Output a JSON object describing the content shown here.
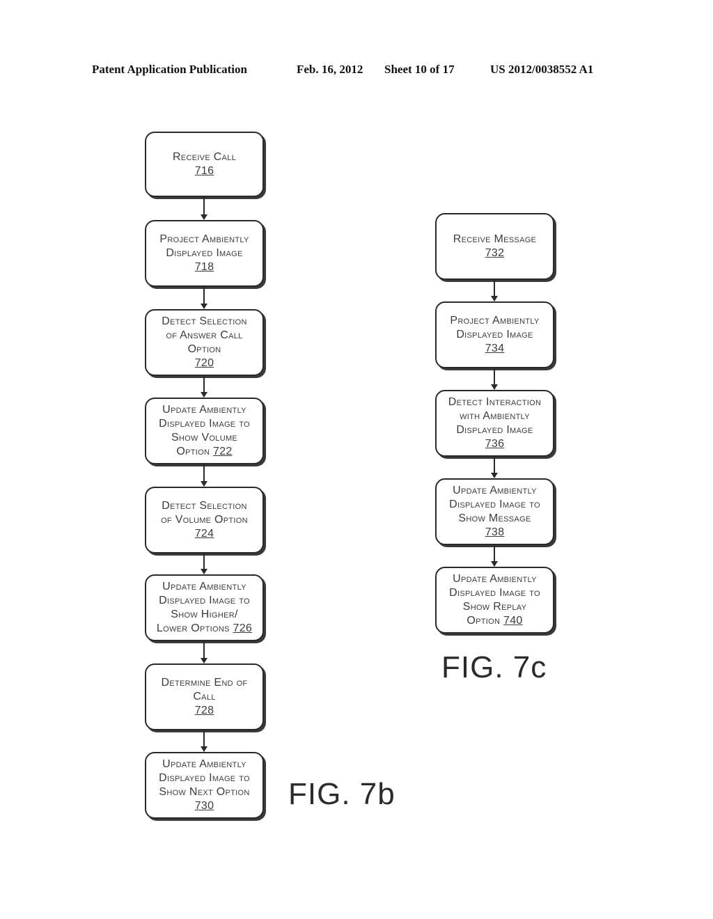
{
  "header": {
    "publication": "Patent Application Publication",
    "date": "Feb. 16, 2012",
    "sheet": "Sheet 10 of 17",
    "patent_number": "US 2012/0038552 A1"
  },
  "fig7b": {
    "label": "FIG. 7b",
    "steps": [
      {
        "lines": [
          "Receive Call"
        ],
        "ref": "716"
      },
      {
        "lines": [
          "Project Ambiently",
          "Displayed Image"
        ],
        "ref": "718"
      },
      {
        "lines": [
          "Detect Selection",
          "of Answer Call",
          "Option"
        ],
        "ref": "720"
      },
      {
        "lines": [
          "Update Ambiently",
          "Displayed Image to",
          "Show Volume"
        ],
        "last_line_prefix": "Option",
        "ref": "722"
      },
      {
        "lines": [
          "Detect Selection",
          "of Volume Option"
        ],
        "ref": "724"
      },
      {
        "lines": [
          "Update Ambiently",
          "Displayed Image to",
          "Show Higher/"
        ],
        "last_line_prefix": "Lower Options",
        "ref": "726"
      },
      {
        "lines": [
          "Determine End of",
          "Call"
        ],
        "ref": "728"
      },
      {
        "lines": [
          "Update Ambiently",
          "Displayed Image to",
          "Show Next Option"
        ],
        "ref": "730"
      }
    ]
  },
  "fig7c": {
    "label": "FIG. 7c",
    "steps": [
      {
        "lines": [
          "Receive Message"
        ],
        "ref": "732"
      },
      {
        "lines": [
          "Project Ambiently",
          "Displayed Image"
        ],
        "ref": "734"
      },
      {
        "lines": [
          "Detect Interaction",
          "with Ambiently",
          "Displayed Image"
        ],
        "ref": "736"
      },
      {
        "lines": [
          "Update Ambiently",
          "Displayed Image to",
          "Show Message"
        ],
        "ref": "738"
      },
      {
        "lines": [
          "Update Ambiently",
          "Displayed Image to",
          "Show Replay"
        ],
        "last_line_prefix": "Option",
        "ref": "740"
      }
    ]
  }
}
